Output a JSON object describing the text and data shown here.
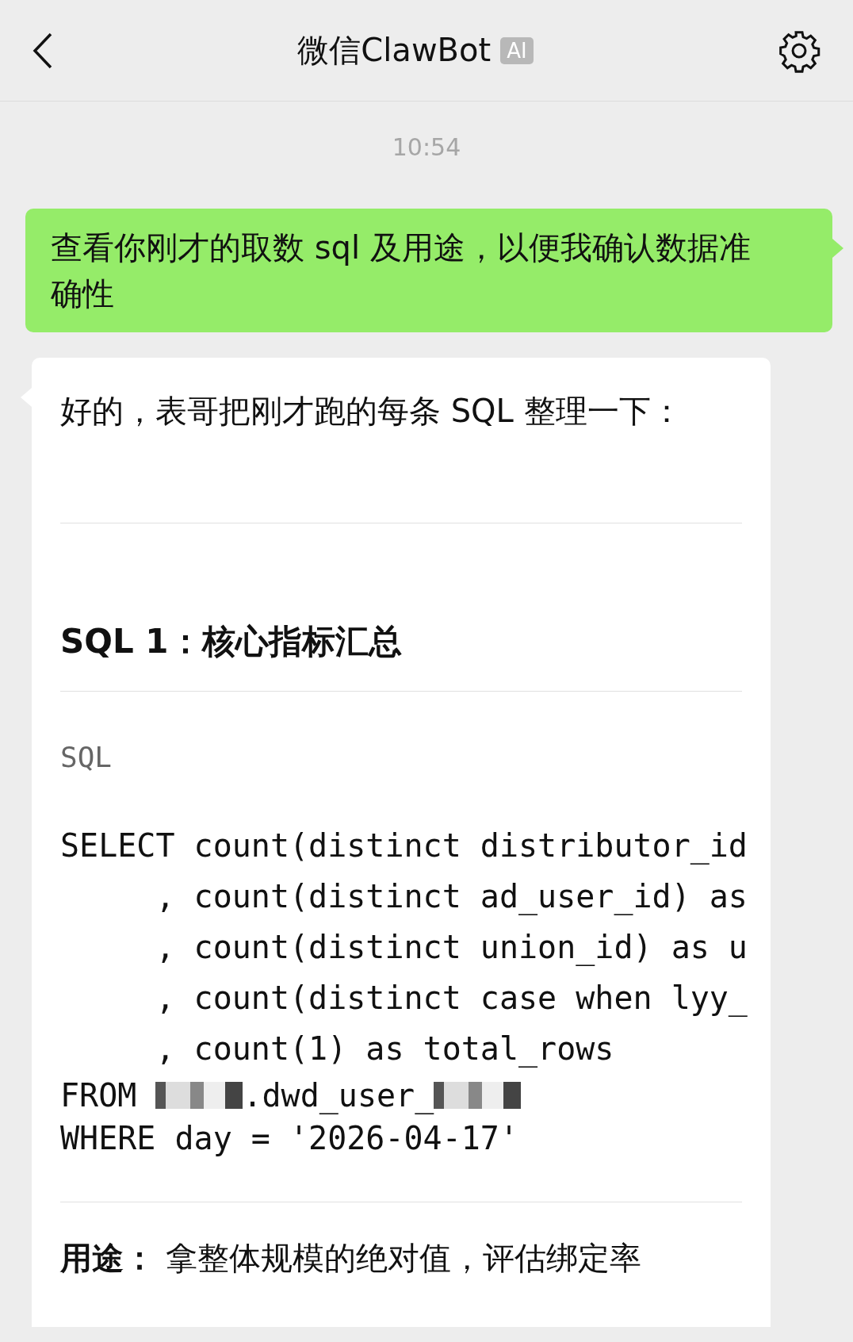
{
  "header": {
    "title": "微信ClawBot",
    "badge": "AI"
  },
  "timestamp": "10:54",
  "user_message": {
    "text": "查看你刚才的取数 sql 及用途，以便我确认数据准确性"
  },
  "bot_message": {
    "intro": "好的，表哥把刚才跑的每条 SQL 整理一下：",
    "heading": "SQL 1：核心指标汇总",
    "code_label": "SQL",
    "code_lines": [
      {
        "segments": [
          {
            "kind": "text",
            "text": "SELECT count(distinct distributor_id"
          }
        ]
      },
      {
        "segments": [
          {
            "kind": "text",
            "text": "     , count(distinct ad_user_id) as"
          }
        ]
      },
      {
        "segments": [
          {
            "kind": "text",
            "text": "     , count(distinct union_id) as u"
          }
        ]
      },
      {
        "segments": [
          {
            "kind": "text",
            "text": "     , count(distinct case when lyy_"
          }
        ]
      },
      {
        "segments": [
          {
            "kind": "text",
            "text": "     , count(1) as total_rows"
          }
        ]
      },
      {
        "segments": [
          {
            "kind": "text",
            "text": "FROM "
          },
          {
            "kind": "redacted"
          },
          {
            "kind": "text",
            "text": ".dwd_user_"
          },
          {
            "kind": "redacted"
          }
        ]
      },
      {
        "segments": [
          {
            "kind": "text",
            "text": "WHERE day = '2026-04-17'"
          }
        ]
      }
    ],
    "usage": "**用途：** 拿整体规模的绝对值，评估绑定率"
  }
}
